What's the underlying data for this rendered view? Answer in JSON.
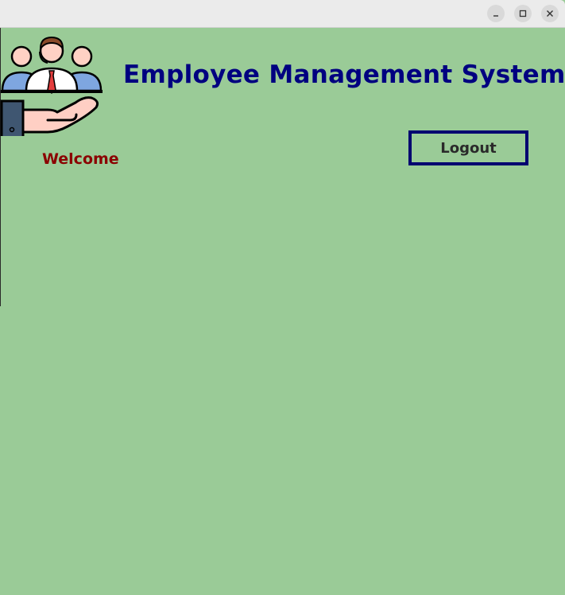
{
  "window": {
    "controls": {
      "minimize_icon": "minimize-icon",
      "maximize_icon": "maximize-icon",
      "close_icon": "close-icon"
    }
  },
  "header": {
    "title": "Employee Management System",
    "logo_icon": "employees-in-hand-icon"
  },
  "main": {
    "welcome_text": "Welcome",
    "logout_label": "Logout"
  },
  "colors": {
    "background": "#9acb97",
    "title": "#000080",
    "welcome": "#8b0000",
    "logout_border": "#000070"
  }
}
